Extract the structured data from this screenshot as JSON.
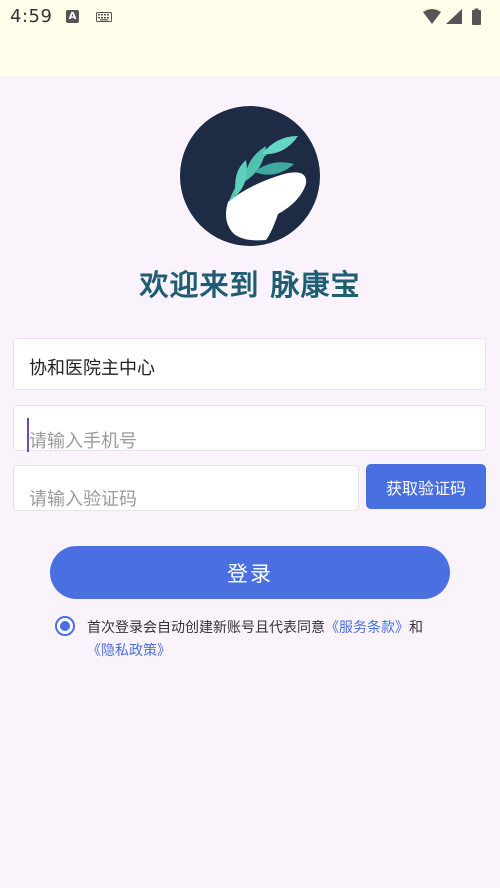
{
  "status_bar": {
    "time": "4:59",
    "a_badge": "A"
  },
  "app": {
    "title": "欢迎来到 脉康宝"
  },
  "form": {
    "hospital_value": "协和医院主中心",
    "phone_placeholder": "请输入手机号",
    "code_placeholder": "请输入验证码",
    "get_code_label": "获取验证码",
    "login_label": "登录"
  },
  "agreement": {
    "checked": true,
    "text_prefix": "首次登录会自动创建新账号且代表同意",
    "terms_link": "《服务条款》",
    "and_text": "和",
    "privacy_link": "《隐私政策》"
  },
  "colors": {
    "primary": "#4A6FE0",
    "title": "#1F5D73",
    "logo_bg": "#1E2B45",
    "leaf": "#4FC3B0",
    "background": "#FAF3FC",
    "status_bar_bg": "#FEFEEA"
  }
}
